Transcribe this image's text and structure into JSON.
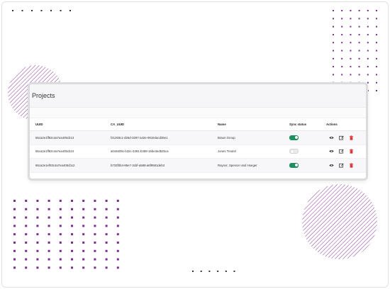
{
  "page": {
    "title": "Projects"
  },
  "table": {
    "headers": {
      "uuid": "UUID",
      "ca_uuid": "CA_UUID",
      "name": "Name",
      "sync": "Sync status",
      "actions": "Actions"
    },
    "rows": [
      {
        "uuid": "65ca2e1ff83c4a7ea405cb13",
        "ca_uuid": "f21293c1-d26d-3297-a42e-90164acd35e1",
        "name": "Braun Group",
        "sync": true
      },
      {
        "uuid": "65ca2e1ff83c4a7ea405cb24",
        "ca_uuid": "a044609c-b32c-3391-b389-16be3ed525ca",
        "name": "Jones Treutel",
        "sync": false
      },
      {
        "uuid": "65ca2e1ef83c4a7ea405cb12",
        "ca_uuid": "b733f0b4-85e7-3cbf-a588-a6f9591deb3",
        "name": "Raynor, Spencer and Hoeger",
        "sync": true
      }
    ]
  },
  "colors": {
    "accent": "#7b2d8e",
    "sync_on": "#1f8f5f",
    "delete": "#d9383a"
  },
  "icons": {
    "view": "eye-icon",
    "edit": "edit-icon",
    "delete": "trash-icon"
  }
}
